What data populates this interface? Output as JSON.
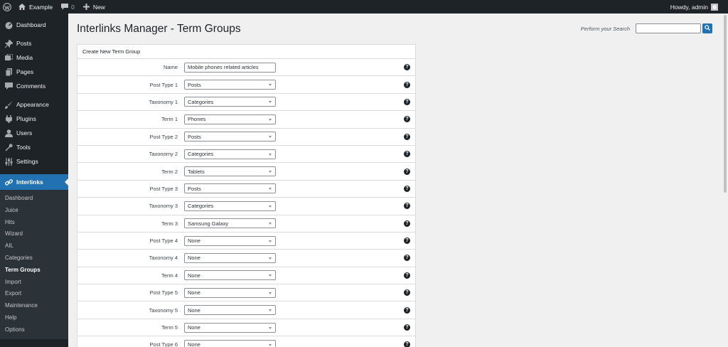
{
  "adminbar": {
    "site_name": "Example",
    "comments_count": "0",
    "new_label": "New",
    "greeting": "Howdy, admin"
  },
  "sidebar": {
    "items": [
      {
        "label": "Dashboard",
        "icon": "dashboard-icon"
      },
      {
        "label": "Posts",
        "icon": "pin-icon"
      },
      {
        "label": "Media",
        "icon": "media-icon"
      },
      {
        "label": "Pages",
        "icon": "pages-icon"
      },
      {
        "label": "Comments",
        "icon": "comment-icon"
      },
      {
        "label": "Appearance",
        "icon": "brush-icon"
      },
      {
        "label": "Plugins",
        "icon": "plugin-icon"
      },
      {
        "label": "Users",
        "icon": "users-icon"
      },
      {
        "label": "Tools",
        "icon": "wrench-icon"
      },
      {
        "label": "Settings",
        "icon": "settings-icon"
      },
      {
        "label": "Interlinks",
        "icon": "link-icon"
      }
    ],
    "submenu": [
      "Dashboard",
      "Juice",
      "Hits",
      "Wizard",
      "AIL",
      "Categories",
      "Term Groups",
      "Import",
      "Export",
      "Maintenance",
      "Help",
      "Options"
    ],
    "current_submenu": "Term Groups"
  },
  "page": {
    "title": "Interlinks Manager - Term Groups",
    "search_label": "Perform your Search",
    "search_placeholder": ""
  },
  "form": {
    "header": "Create New Term Group",
    "rows": [
      {
        "label": "Name",
        "value": "Mobile phones related articles",
        "type": "text"
      },
      {
        "label": "Post Type 1",
        "value": "Posts",
        "type": "select"
      },
      {
        "label": "Taxonomy 1",
        "value": "Categories",
        "type": "select"
      },
      {
        "label": "Term 1",
        "value": "Phones",
        "type": "select"
      },
      {
        "label": "Post Type 2",
        "value": "Posts",
        "type": "select"
      },
      {
        "label": "Taxonomy 2",
        "value": "Categories",
        "type": "select"
      },
      {
        "label": "Term 2",
        "value": "Tablets",
        "type": "select"
      },
      {
        "label": "Post Type 3",
        "value": "Posts",
        "type": "select"
      },
      {
        "label": "Taxonomy 3",
        "value": "Categories",
        "type": "select"
      },
      {
        "label": "Term 3",
        "value": "Samsung Galaxy",
        "type": "select"
      },
      {
        "label": "Post Type 4",
        "value": "None",
        "type": "select"
      },
      {
        "label": "Taxonomy 4",
        "value": "None",
        "type": "select"
      },
      {
        "label": "Term 4",
        "value": "None",
        "type": "select"
      },
      {
        "label": "Post Type 5",
        "value": "None",
        "type": "select"
      },
      {
        "label": "Taxonomy 5",
        "value": "None",
        "type": "select"
      },
      {
        "label": "Term 5",
        "value": "None",
        "type": "select"
      },
      {
        "label": "Post Type 6",
        "value": "None",
        "type": "select"
      }
    ]
  },
  "colors": {
    "accent": "#2271b1",
    "admin_dark": "#1d2327"
  }
}
